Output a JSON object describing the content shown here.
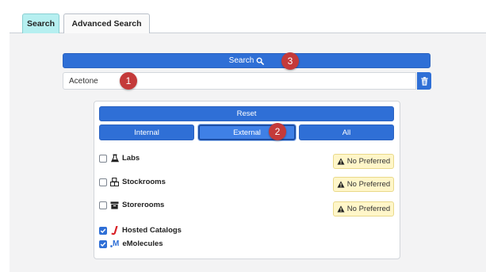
{
  "tabs": [
    {
      "label": "Search",
      "active": true
    },
    {
      "label": "Advanced Search",
      "active": false
    }
  ],
  "search": {
    "button_label": "Search",
    "input_value": "Acetone",
    "trash_icon": "trash-icon"
  },
  "filters": {
    "reset_label": "Reset",
    "segments": [
      "Internal",
      "External",
      "All"
    ],
    "selected_segment": "External"
  },
  "options": [
    {
      "label": "Labs",
      "icon": "flask-icon",
      "checked": false,
      "badge": "No Preferred"
    },
    {
      "label": "Stockrooms",
      "icon": "boxes-icon",
      "checked": false,
      "badge": "No Preferred"
    },
    {
      "label": "Storerooms",
      "icon": "archive-icon",
      "checked": false,
      "badge": "No Preferred"
    },
    {
      "label": "Hosted Catalogs",
      "icon": "hosted-catalogs-logo-icon",
      "checked": true
    },
    {
      "label": "eMolecules",
      "icon": "emolecules-logo-icon",
      "checked": true,
      "logo_text": "M"
    }
  ],
  "markers": [
    "1",
    "2",
    "3"
  ],
  "colors": {
    "primary": "#2f6fd6",
    "active_tab": "#b6eff0",
    "badge_bg": "#fff6c9",
    "marker": "#c43a3a"
  }
}
